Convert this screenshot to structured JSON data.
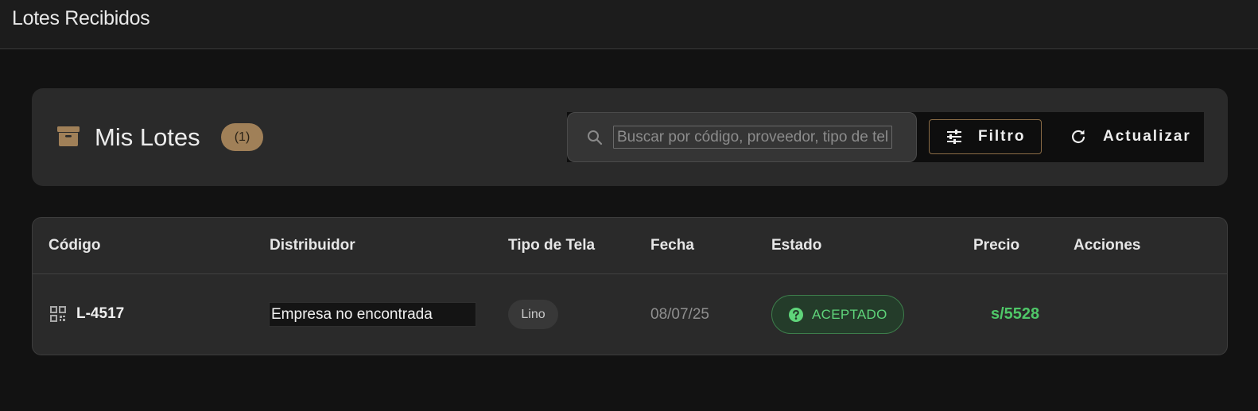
{
  "topbar": {
    "title": "Lotes Recibidos"
  },
  "card": {
    "icon": "archive-box-icon",
    "heading": "Mis Lotes",
    "count": "(1)",
    "search": {
      "placeholder": "Buscar por código, proveedor, tipo de tela",
      "value": ""
    },
    "filter_label": "Filtro",
    "refresh_label": "Actualizar"
  },
  "table": {
    "headers": [
      "Código",
      "Distribuidor",
      "Tipo de Tela",
      "Fecha",
      "Estado",
      "Precio",
      "Acciones"
    ],
    "rows": [
      {
        "codigo": "L-4517",
        "distribuidor": "Empresa no encontrada",
        "tipo_tela": "Lino",
        "fecha": "08/07/25",
        "estado": "ACEPTADO",
        "precio": "s/5528",
        "acciones": ""
      }
    ]
  },
  "colors": {
    "accent": "#a08058",
    "success": "#5fd47a",
    "background": "#121212",
    "surface": "#2a2a2a"
  }
}
